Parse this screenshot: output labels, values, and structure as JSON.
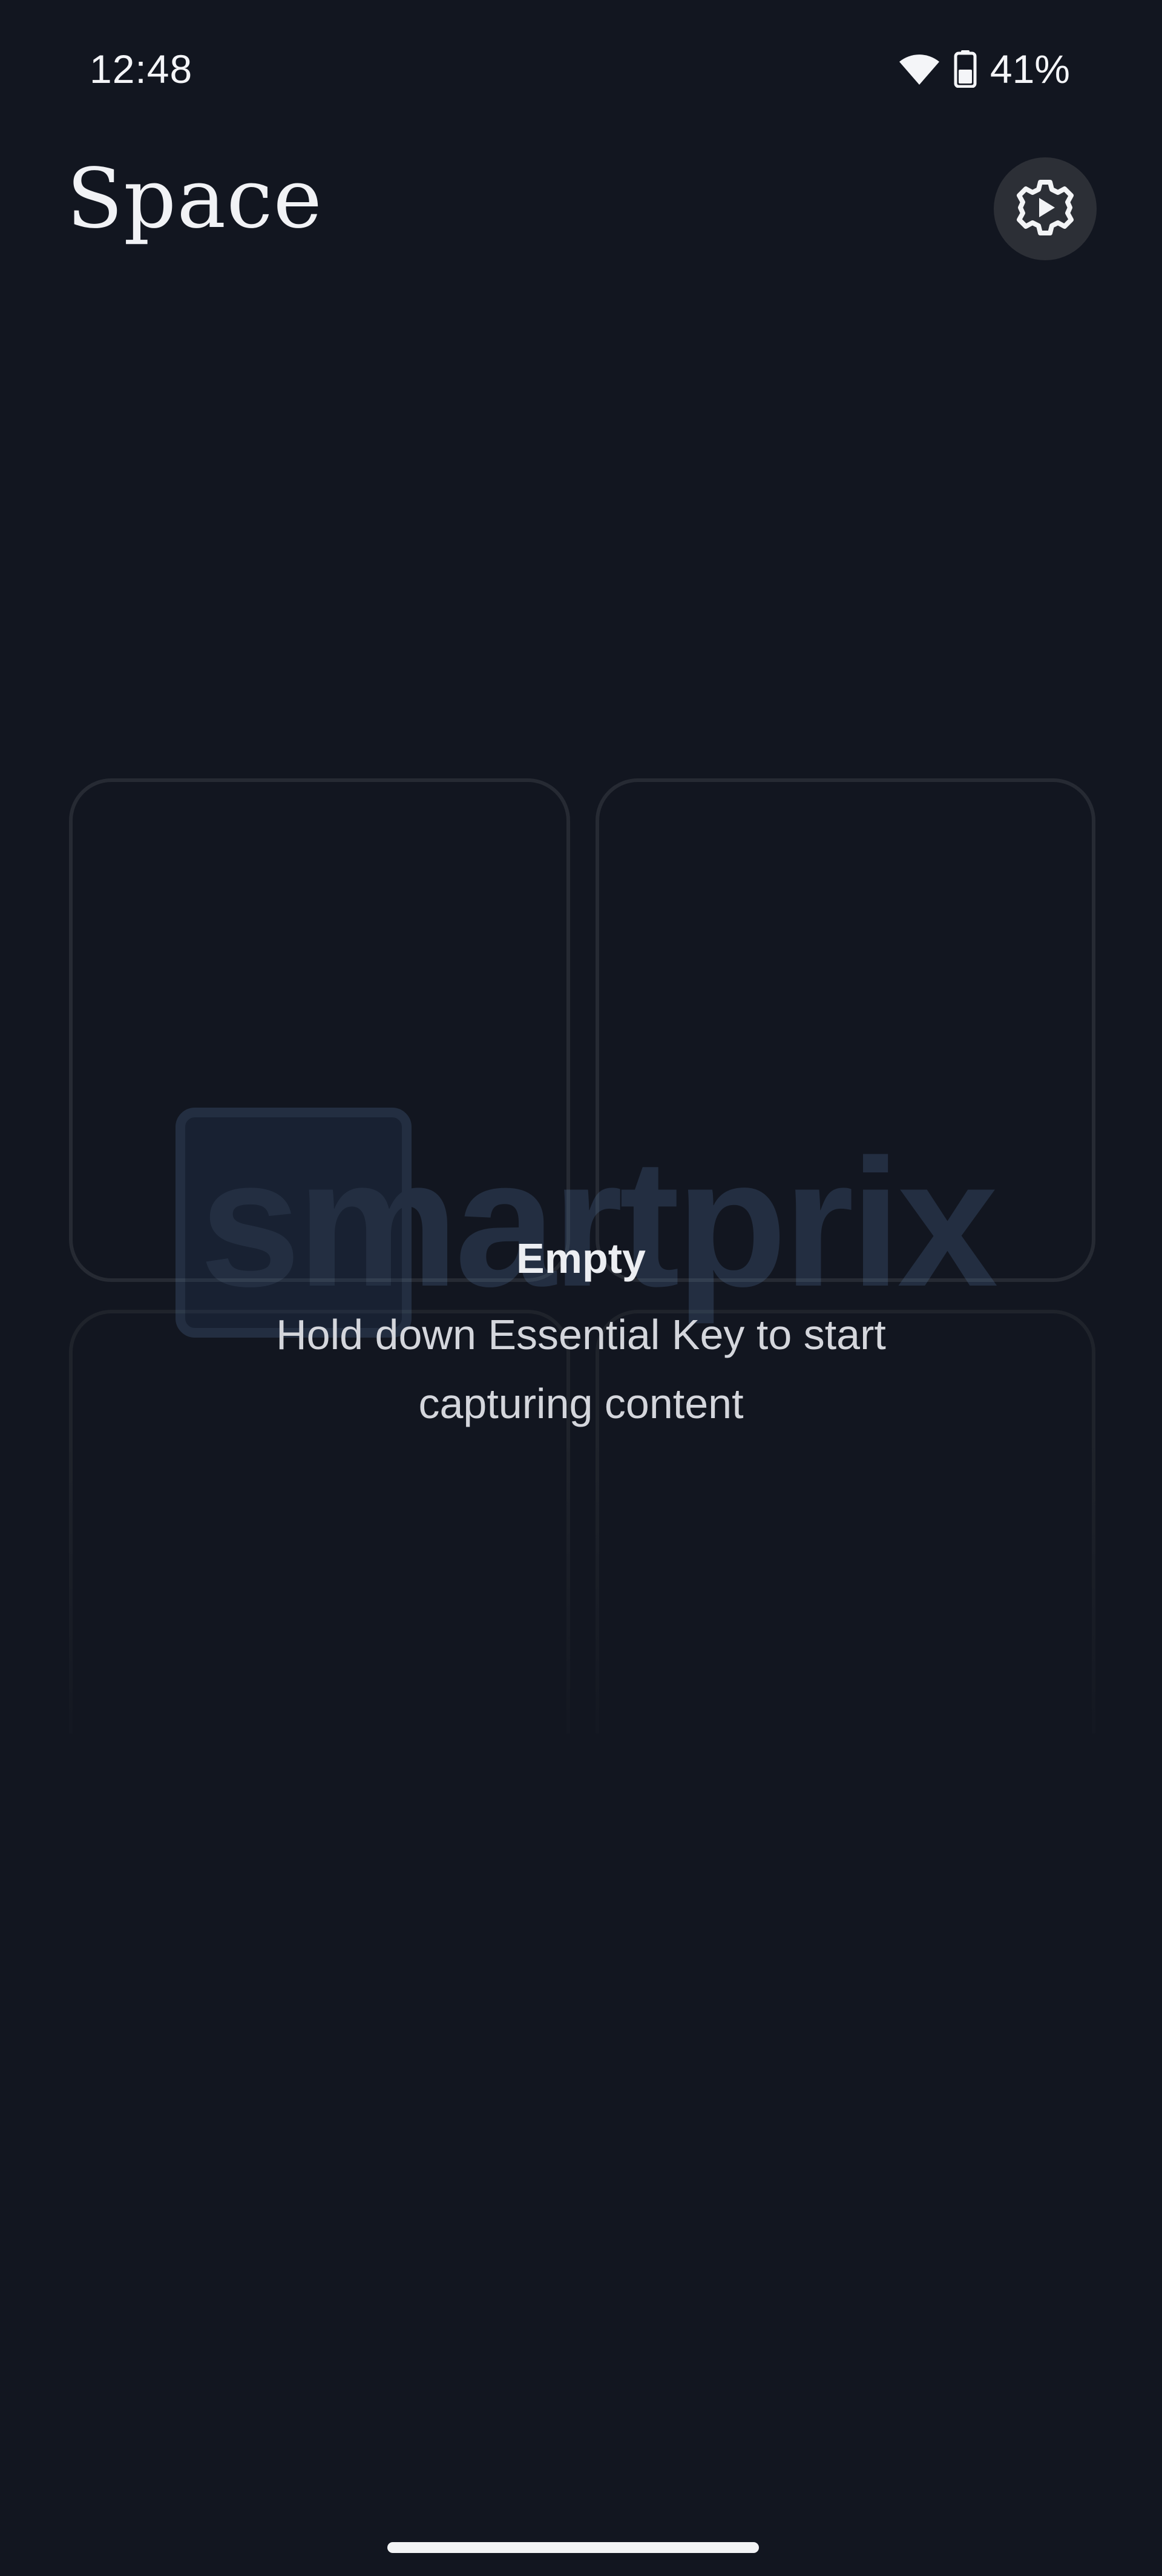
{
  "status_bar": {
    "time": "12:48",
    "battery_percent": "41%",
    "wifi_icon": "wifi-icon",
    "battery_icon": "battery-icon"
  },
  "header": {
    "title": "Space",
    "settings_icon": "gear-icon"
  },
  "empty_state": {
    "title": "Empty",
    "message": "Hold down Essential Key to start capturing content"
  },
  "watermark": {
    "text": "smartprix"
  },
  "colors": {
    "background": "#121620",
    "text_primary": "#eceef2",
    "text_secondary": "#d4d6dc",
    "card_border": "#262a33",
    "settings_button_bg": "#2c2f36"
  }
}
